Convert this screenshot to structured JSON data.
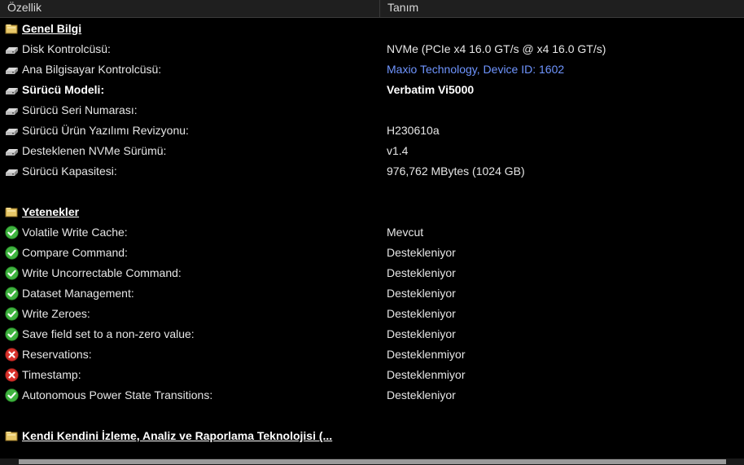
{
  "header": {
    "col1": "Özellik",
    "col2": "Tanım"
  },
  "rows": [
    {
      "type": "section",
      "icon": "folder-icon",
      "label": "Genel Bilgi",
      "value": ""
    },
    {
      "type": "item",
      "icon": "drive-icon",
      "label": "Disk Kontrolcüsü:",
      "value": "NVMe (PCIe x4 16.0 GT/s @ x4 16.0 GT/s)"
    },
    {
      "type": "item-link",
      "icon": "drive-icon",
      "label": "Ana Bilgisayar Kontrolcüsü:",
      "value": "Maxio Technology, Device ID: 1602"
    },
    {
      "type": "bold",
      "icon": "drive-icon",
      "label": "Sürücü Modeli:",
      "value": "Verbatim Vi5000"
    },
    {
      "type": "item",
      "icon": "drive-icon",
      "label": "Sürücü Seri Numarası:",
      "value": ""
    },
    {
      "type": "item",
      "icon": "drive-icon",
      "label": "Sürücü Ürün Yazılımı Revizyonu:",
      "value": "H230610a"
    },
    {
      "type": "item",
      "icon": "drive-icon",
      "label": "Desteklenen NVMe Sürümü:",
      "value": "v1.4"
    },
    {
      "type": "item",
      "icon": "drive-icon",
      "label": "Sürücü Kapasitesi:",
      "value": "976,762 MBytes (1024 GB)"
    },
    {
      "type": "blank",
      "icon": "",
      "label": "",
      "value": ""
    },
    {
      "type": "section",
      "icon": "folder-icon",
      "label": "Yetenekler",
      "value": ""
    },
    {
      "type": "item",
      "icon": "check-icon",
      "label": "Volatile Write Cache:",
      "value": "Mevcut"
    },
    {
      "type": "item",
      "icon": "check-icon",
      "label": "Compare Command:",
      "value": "Destekleniyor"
    },
    {
      "type": "item",
      "icon": "check-icon",
      "label": "Write Uncorrectable Command:",
      "value": "Destekleniyor"
    },
    {
      "type": "item",
      "icon": "check-icon",
      "label": "Dataset Management:",
      "value": "Destekleniyor"
    },
    {
      "type": "item",
      "icon": "check-icon",
      "label": "Write Zeroes:",
      "value": "Destekleniyor"
    },
    {
      "type": "item",
      "icon": "check-icon",
      "label": "Save field set to a non-zero value:",
      "value": "Destekleniyor"
    },
    {
      "type": "item",
      "icon": "cross-icon",
      "label": "Reservations:",
      "value": "Desteklenmiyor"
    },
    {
      "type": "item",
      "icon": "cross-icon",
      "label": "Timestamp:",
      "value": "Desteklenmiyor"
    },
    {
      "type": "item",
      "icon": "check-icon",
      "label": "Autonomous Power State Transitions:",
      "value": "Destekleniyor"
    },
    {
      "type": "blank",
      "icon": "",
      "label": "",
      "value": ""
    },
    {
      "type": "section",
      "icon": "folder-icon",
      "label": "Kendi Kendini İzleme, Analiz ve Raporlama Teknolojisi (...",
      "value": ""
    }
  ],
  "colors": {
    "background": "#000000",
    "link": "#6f95ff",
    "check": "#3fb33f",
    "cross": "#d8312b",
    "folder": "#e8c869"
  }
}
